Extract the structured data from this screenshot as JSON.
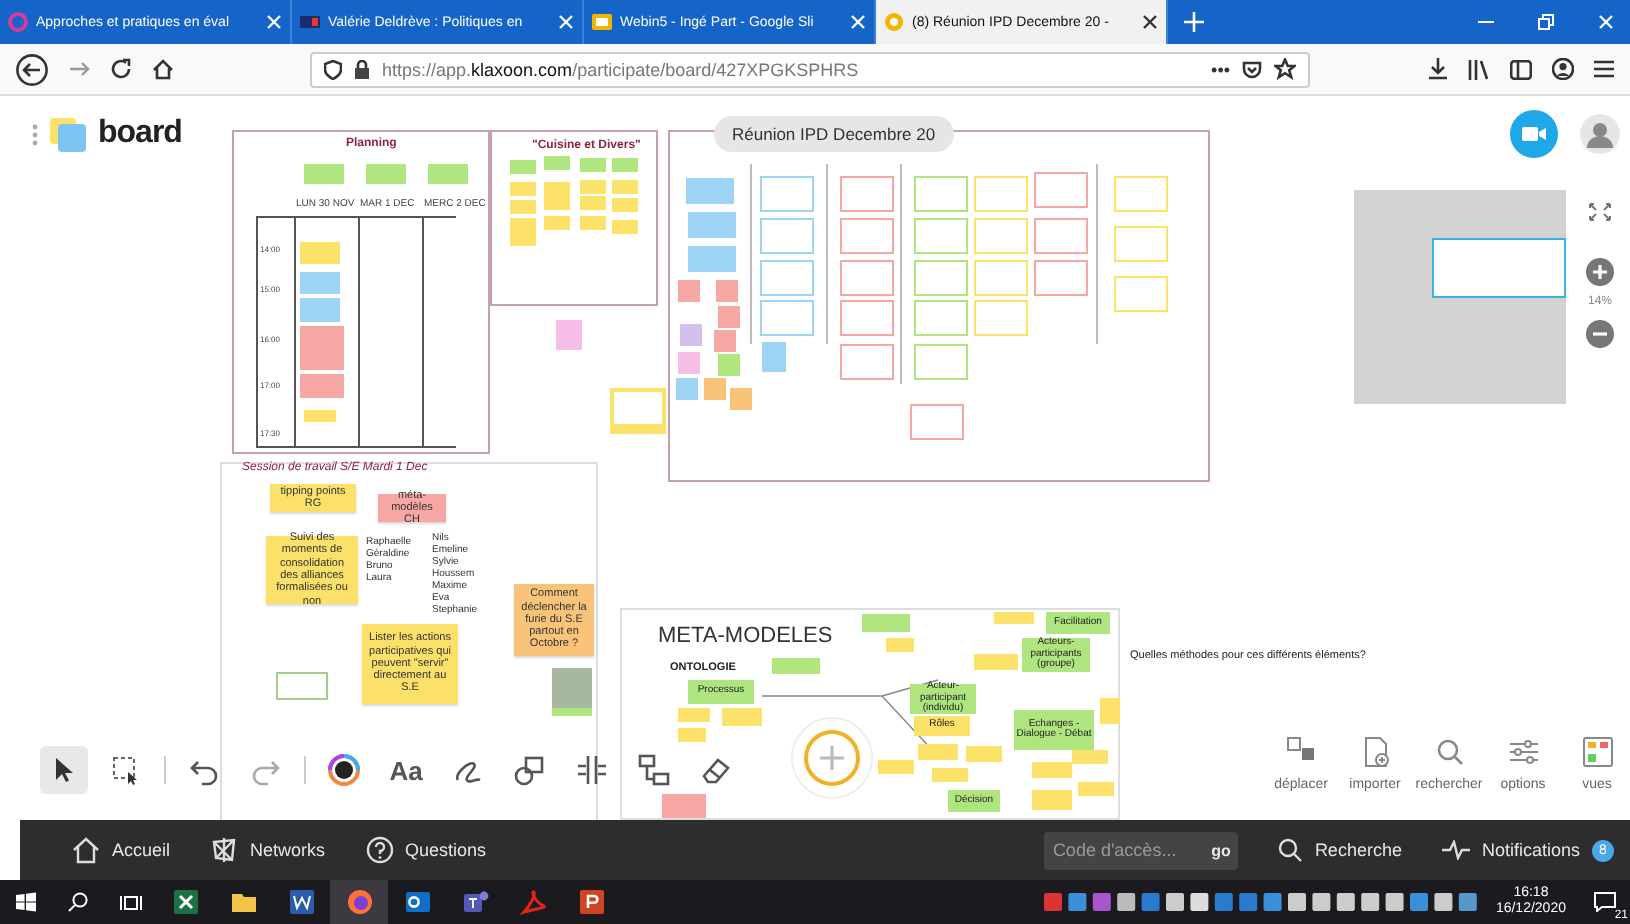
{
  "browser": {
    "tabs": [
      {
        "title": "Approches et pratiques en éval",
        "kind": "ring",
        "selected": false
      },
      {
        "title": "Valérie Deldrève : Politiques en",
        "kind": "letters",
        "selected": false
      },
      {
        "title": "Webin5 - Ingé Part - Google Sli",
        "kind": "slides",
        "selected": false
      },
      {
        "title": "(8) Réunion IPD Decembre 20 -",
        "kind": "klaxoon",
        "selected": true
      }
    ],
    "address": {
      "scheme": "https://app.",
      "domain": "klaxoon.com",
      "path": "/participate/board/427XPGKSPHRS"
    },
    "page_actions": "•••"
  },
  "board": {
    "logo": "board",
    "title": "Réunion IPD Decembre 20",
    "zoom": "14%",
    "planning": {
      "title": "Planning",
      "days": [
        "LUN 30 NOV",
        "MAR 1 DEC",
        "MERC 2 DEC"
      ],
      "times": [
        "14:00",
        "15:00",
        "16:00",
        "17:00",
        "17:30"
      ]
    },
    "cuisine": {
      "title": "\"Cuisine et Divers\""
    },
    "session": {
      "title": "Session de travail S/E Mardi 1 Dec",
      "notes": [
        {
          "kind": "sticky",
          "text": "tipping points RG",
          "color": "#fbe06a"
        },
        {
          "kind": "sticky",
          "text": "méta-modèles CH",
          "color": "#f7a7a4"
        },
        {
          "kind": "sticky",
          "text": "Suivi des moments de consolidation des alliances formalisées ou non",
          "color": "#fbe06a"
        },
        {
          "kind": "list",
          "text": "Raphaelle Géraldine Bruno Laura"
        },
        {
          "kind": "list",
          "text": "Nils Emeline Sylvie Houssem Maxime Eva Stephanie"
        },
        {
          "kind": "sticky",
          "text": "Lister les actions participatives qui peuvent \"servir\" directement au S.E",
          "color": "#fbe06a"
        },
        {
          "kind": "sticky",
          "text": "Comment déclencher la furie du S.E partout en Octobre ?",
          "color": "#f9c47a"
        }
      ]
    },
    "meta": {
      "title": "META-MODELES",
      "subtitle": "ONTOLOGIE",
      "question": "Quelles méthodes pour ces différents éléments?",
      "nodes": [
        {
          "text": "Facilitation",
          "color": "#aee57f"
        },
        {
          "text": "Acteurs-participants (groupe)",
          "color": "#aee57f"
        },
        {
          "text": "Processus",
          "color": "#aee57f"
        },
        {
          "text": "Acteur-participant (individu)",
          "color": "#aee57f"
        },
        {
          "text": "Rôles",
          "color": "#fbe06a"
        },
        {
          "text": "Echanges - Dialogue - Débat",
          "color": "#aee57f"
        },
        {
          "text": "Décision",
          "color": "#aee57f"
        }
      ]
    },
    "tools": [
      {
        "kind": "select",
        "selected": true
      },
      {
        "kind": "multiselect",
        "selected": false
      },
      {
        "kind": "undo",
        "selected": false
      },
      {
        "kind": "redo",
        "selected": false
      },
      {
        "kind": "color",
        "selected": false
      },
      {
        "kind": "text",
        "label": "Aa",
        "selected": false
      },
      {
        "kind": "draw",
        "selected": false
      },
      {
        "kind": "shape",
        "selected": false
      },
      {
        "kind": "grid",
        "selected": false
      },
      {
        "kind": "connector",
        "selected": false
      },
      {
        "kind": "eraser",
        "selected": false
      }
    ],
    "actions": [
      {
        "kind": "move",
        "label": "déplacer"
      },
      {
        "kind": "import",
        "label": "importer"
      },
      {
        "kind": "search",
        "label": "rechercher"
      },
      {
        "kind": "options",
        "label": "options"
      },
      {
        "kind": "views",
        "label": "vues"
      }
    ]
  },
  "footer": {
    "nav": [
      {
        "kind": "home",
        "label": "Accueil"
      },
      {
        "kind": "network",
        "label": "Networks"
      },
      {
        "kind": "question",
        "label": "Questions"
      }
    ],
    "code_field": {
      "placeholder": "Code d'accès..."
    },
    "go": "go",
    "search": "Recherche",
    "notifications": "Notifications",
    "badge": "8"
  },
  "taskbar": {
    "apps": [
      {
        "kind": "excel",
        "selected": false
      },
      {
        "kind": "folder",
        "selected": false
      },
      {
        "kind": "word",
        "selected": false
      },
      {
        "kind": "firefox",
        "selected": true
      },
      {
        "kind": "outlook",
        "selected": false
      },
      {
        "kind": "teams",
        "selected": false
      },
      {
        "kind": "pdf",
        "selected": false
      },
      {
        "kind": "powerpoint",
        "selected": false
      }
    ],
    "time": "16:18",
    "date": "16/12/2020",
    "notification_count": "21"
  }
}
